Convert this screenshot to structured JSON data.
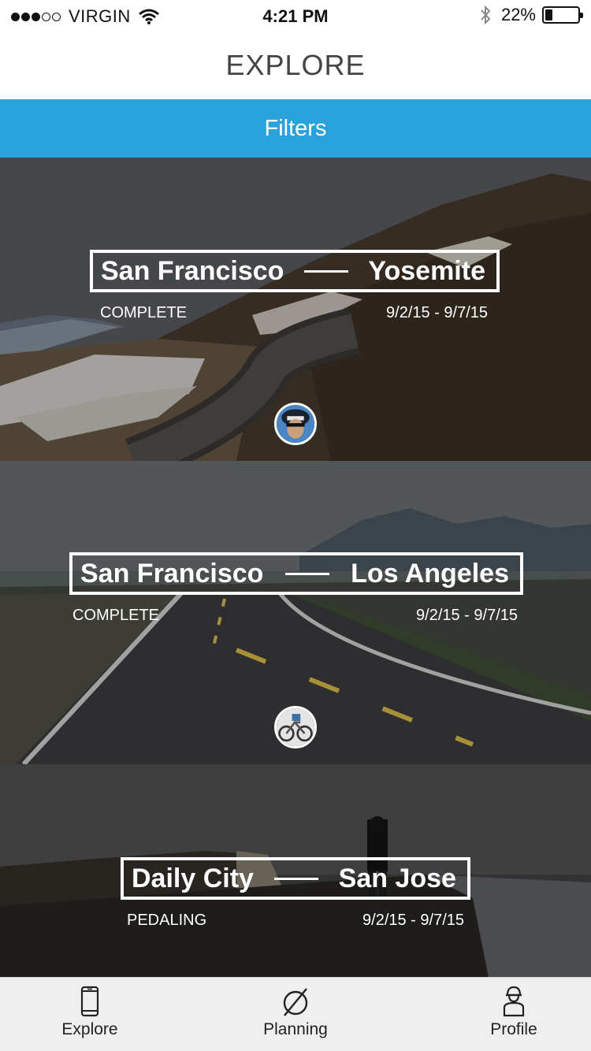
{
  "status_bar": {
    "carrier": "VIRGIN",
    "signal_bars_filled": 3,
    "signal_bars_total": 5,
    "time": "4:21 PM",
    "battery_text": "22%",
    "battery_level": 0.22
  },
  "header": {
    "title": "EXPLORE"
  },
  "filters": {
    "label": "Filters",
    "color": "#2aa3dc"
  },
  "routes": [
    {
      "from": "San Francisco",
      "to": "Yosemite",
      "status": "COMPLETE",
      "dates": "9/2/15 - 9/7/15",
      "background": "snowy-mountain-road",
      "avatar": "cyclist-helmet-avatar"
    },
    {
      "from": "San Francisco",
      "to": "Los Angeles",
      "status": "COMPLETE",
      "dates": "9/2/15 - 9/7/15",
      "background": "open-highway-mountains",
      "avatar": "bicycle-avatar"
    },
    {
      "from": "Daily City",
      "to": "San Jose",
      "status": "PEDALING",
      "dates": "9/2/15 - 9/7/15",
      "background": "coastal-cliff-person",
      "avatar": null
    }
  ],
  "tab_bar": {
    "tabs": [
      {
        "label": "Explore",
        "icon": "phone-icon"
      },
      {
        "label": "Planning",
        "icon": "compass-icon"
      },
      {
        "label": "Profile",
        "icon": "person-icon"
      }
    ]
  }
}
